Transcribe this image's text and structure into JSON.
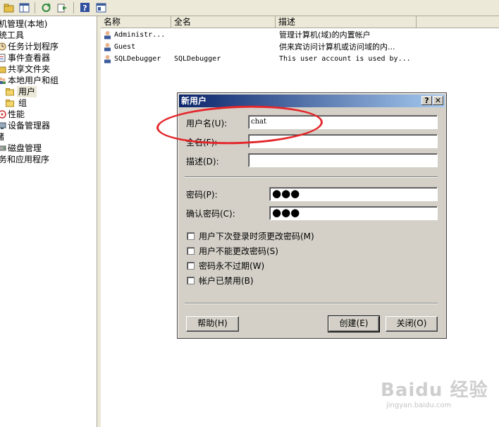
{
  "tree": [
    {
      "label": "机管理(本地)",
      "indent": 0,
      "icon": "none"
    },
    {
      "label": "统工具",
      "indent": 0,
      "icon": "none"
    },
    {
      "label": "任务计划程序",
      "indent": 1,
      "icon": "clock-icon"
    },
    {
      "label": "事件查看器",
      "indent": 1,
      "icon": "event-viewer-icon"
    },
    {
      "label": "共享文件夹",
      "indent": 1,
      "icon": "shared-folder-icon"
    },
    {
      "label": "本地用户和组",
      "indent": 1,
      "icon": "users-group-icon"
    },
    {
      "label": "用户",
      "indent": 2,
      "icon": "folder-icon"
    },
    {
      "label": "组",
      "indent": 2,
      "icon": "folder-icon"
    },
    {
      "label": "性能",
      "indent": 1,
      "icon": "performance-icon"
    },
    {
      "label": "设备管理器",
      "indent": 1,
      "icon": "device-manager-icon"
    },
    {
      "label": "储",
      "indent": 0,
      "icon": "none"
    },
    {
      "label": "磁盘管理",
      "indent": 1,
      "icon": "disk-icon"
    },
    {
      "label": "务和应用程序",
      "indent": 0,
      "icon": "none"
    }
  ],
  "list": {
    "columns": [
      "名称",
      "全名",
      "描述"
    ],
    "rows": [
      {
        "name": "Administr...",
        "full_name": "",
        "description": "管理计算机(域)的内置帐户"
      },
      {
        "name": "Guest",
        "full_name": "",
        "description": "供来宾访问计算机或访问域的内..."
      },
      {
        "name": "SQLDebugger",
        "full_name": "SQLDebugger",
        "description": "This user account is used by..."
      }
    ]
  },
  "dialog": {
    "title": "新用户",
    "help_glyph": "?",
    "close_glyph": "✕",
    "username_label": "用户名(U):",
    "username_value": "chat",
    "fullname_label": "全名(F):",
    "fullname_value": "",
    "description_label": "描述(D):",
    "description_value": "",
    "password_label": "密码(P):",
    "password_mask": "●●●",
    "confirm_label": "确认密码(C):",
    "confirm_mask": "●●●",
    "checkboxes": [
      {
        "label": "用户下次登录时须更改密码(M)",
        "checked": false
      },
      {
        "label": "用户不能更改密码(S)",
        "checked": false
      },
      {
        "label": "密码永不过期(W)",
        "checked": false
      },
      {
        "label": "帐户已禁用(B)",
        "checked": false
      }
    ],
    "help_button": "帮助(H)",
    "create_button": "创建(E)",
    "close_button": "关闭(O)"
  },
  "watermark": "Baidu 经验",
  "watermark_url": "jingyan.baidu.com",
  "colors": {
    "annotation": "#e4262a",
    "title_bar": "#0a246a"
  }
}
